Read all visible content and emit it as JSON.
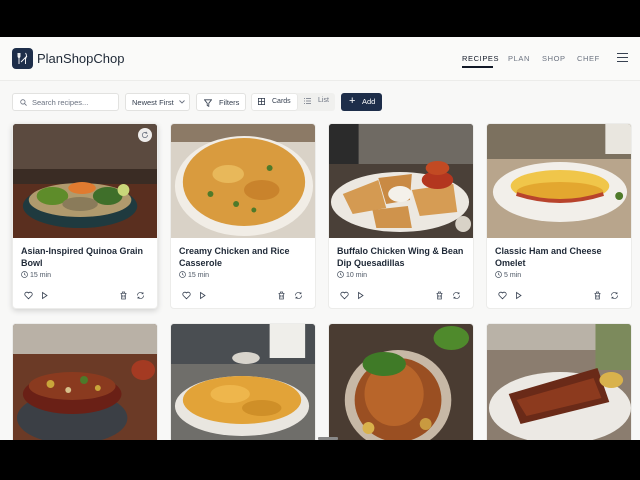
{
  "app": {
    "name": "PlanShopChop",
    "brand_color": "#1e2e4a"
  },
  "nav": {
    "items": [
      {
        "label": "RECIPES",
        "active": true
      },
      {
        "label": "PLAN",
        "active": false
      },
      {
        "label": "SHOP",
        "active": false
      },
      {
        "label": "CHEF",
        "active": false
      }
    ]
  },
  "toolbar": {
    "search_placeholder": "Search recipes...",
    "sort_value": "Newest First",
    "filters_label": "Filters",
    "view_cards_label": "Cards",
    "view_list_label": "List",
    "view_selected": "Cards",
    "add_label": "Add"
  },
  "recipes": [
    {
      "title": "Asian-Inspired Quinoa Grain Bowl",
      "time": "15 min"
    },
    {
      "title": "Creamy Chicken and Rice Casserole",
      "time": "15 min"
    },
    {
      "title": "Buffalo Chicken Wing & Bean Dip Quesadillas",
      "time": "10 min"
    },
    {
      "title": "Classic Ham and Cheese Omelet",
      "time": "5 min"
    }
  ],
  "icons": {
    "favorite": "heart-icon",
    "cook": "play-icon",
    "delete": "trash-icon",
    "regenerate": "refresh-icon"
  }
}
